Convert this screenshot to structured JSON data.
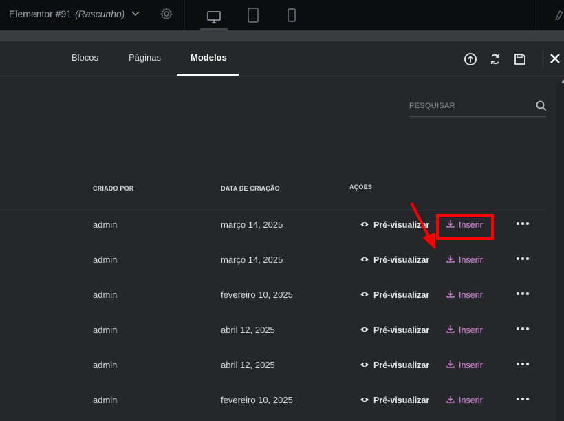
{
  "editor": {
    "doc_title": "Elementor #91",
    "doc_status": "(Rascunho)"
  },
  "tabs": [
    {
      "label": "Blocos"
    },
    {
      "label": "Páginas"
    },
    {
      "label": "Modelos"
    }
  ],
  "search": {
    "placeholder": "PESQUISAR"
  },
  "columns": {
    "created_by": "CRIADO POR",
    "created_date": "DATA DE CRIAÇÃO",
    "actions": "AÇÕES"
  },
  "rows": [
    {
      "author": "admin",
      "date": "março 14, 2025",
      "preview": "Pré-visualizar",
      "insert": "Inserir"
    },
    {
      "author": "admin",
      "date": "março 14, 2025",
      "preview": "Pré-visualizar",
      "insert": "Inserir"
    },
    {
      "author": "admin",
      "date": "fevereiro 10, 2025",
      "preview": "Pré-visualizar",
      "insert": "Inserir"
    },
    {
      "author": "admin",
      "date": "abril 12, 2025",
      "preview": "Pré-visualizar",
      "insert": "Inserir"
    },
    {
      "author": "admin",
      "date": "abril 12, 2025",
      "preview": "Pré-visualizar",
      "insert": "Inserir"
    },
    {
      "author": "admin",
      "date": "fevereiro 10, 2025",
      "preview": "Pré-visualizar",
      "insert": "Inserir"
    }
  ],
  "colors": {
    "background": "#26272b",
    "topbar": "#0c0d0e",
    "insert_accent": "#e08ce6",
    "annotation": "#ff0000"
  },
  "icons": [
    "chevron-down-icon",
    "gear-icon",
    "desktop-icon",
    "tablet-icon",
    "mobile-icon",
    "upload-icon",
    "sync-icon",
    "save-icon",
    "close-icon",
    "search-icon",
    "eye-icon",
    "download-icon",
    "more-icon"
  ]
}
